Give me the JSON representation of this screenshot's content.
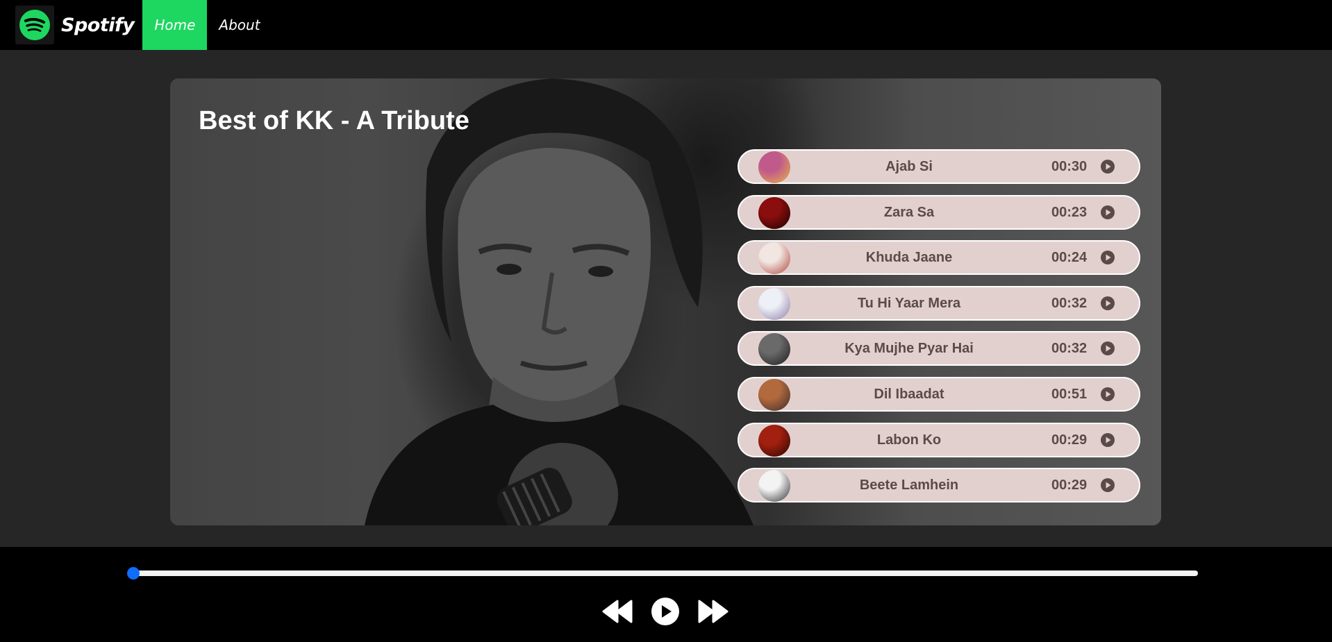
{
  "nav": {
    "brand": "Spotify",
    "links": [
      {
        "label": "Home",
        "active": true
      },
      {
        "label": "About",
        "active": false
      }
    ],
    "accent": "#1ed760"
  },
  "hero": {
    "title": "Best of KK - A Tribute"
  },
  "songs": [
    {
      "title": "Ajab Si",
      "duration": "00:30",
      "thumb_colors": [
        "#c05a8a",
        "#e9b24a"
      ]
    },
    {
      "title": "Zara Sa",
      "duration": "00:23",
      "thumb_colors": [
        "#8a0e0e",
        "#1a0000"
      ]
    },
    {
      "title": "Khuda Jaane",
      "duration": "00:24",
      "thumb_colors": [
        "#f1e6e1",
        "#b0463a"
      ]
    },
    {
      "title": "Tu Hi Yaar Mera",
      "duration": "00:32",
      "thumb_colors": [
        "#eef0f7",
        "#8d7ca8"
      ]
    },
    {
      "title": "Kya Mujhe Pyar Hai",
      "duration": "00:32",
      "thumb_colors": [
        "#6a6a6a",
        "#1c1c1c"
      ]
    },
    {
      "title": "Dil Ibaadat",
      "duration": "00:51",
      "thumb_colors": [
        "#b26a3d",
        "#3b2a2a"
      ]
    },
    {
      "title": "Labon Ko",
      "duration": "00:29",
      "thumb_colors": [
        "#a1200f",
        "#2a0500"
      ]
    },
    {
      "title": "Beete Lamhein",
      "duration": "00:29",
      "thumb_colors": [
        "#f3f3f3",
        "#303030"
      ]
    }
  ],
  "player": {
    "progress_percent": 0,
    "progress_color": "#0d6efd"
  },
  "icons": {
    "logo": "spotify-logo-icon",
    "song_play": "play-circle-icon",
    "prev": "backward-icon",
    "play": "play-circle-icon",
    "next": "forward-icon"
  }
}
